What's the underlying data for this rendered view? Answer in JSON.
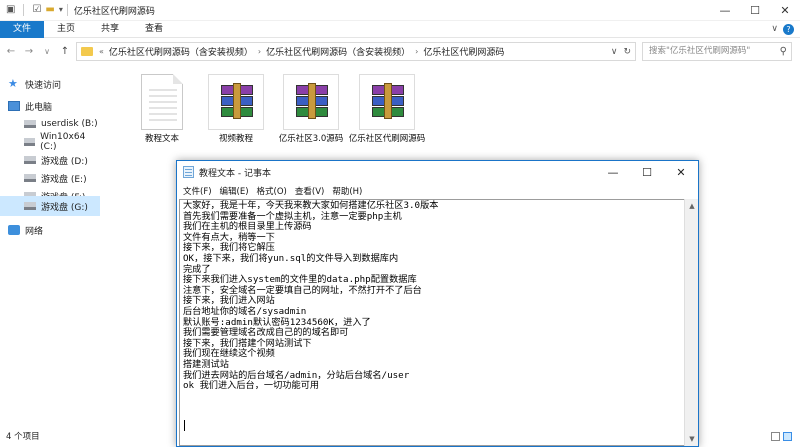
{
  "explorer": {
    "title": "亿乐社区代刷网源码",
    "qa_icons": [
      "window-icon",
      "properties-icon",
      "folder-icon",
      "dropdown-icon"
    ],
    "window_controls": {
      "minimize": "—",
      "maximize": "☐",
      "close": "✕"
    },
    "ribbon_tabs": [
      "文件",
      "主页",
      "共享",
      "查看"
    ],
    "ribbon_chevron": "∨",
    "help": "?",
    "nav_buttons": {
      "back": "←",
      "forward": "→",
      "recent": "∨",
      "up": "↑"
    },
    "breadcrumb": {
      "prefix": "«",
      "items": [
        "亿乐社区代刷网源码（含安装视频）",
        "亿乐社区代刷网源码（含安装视频）",
        "亿乐社区代刷网源码"
      ],
      "separator": "›"
    },
    "address_right": {
      "dropdown": "∨",
      "refresh": "↻"
    },
    "search_placeholder": "搜索\"亿乐社区代刷网源码\"",
    "nav_pane": [
      {
        "label": "快速访问",
        "icon": "star-icon"
      },
      {
        "label": "此电脑",
        "icon": "computer-icon"
      },
      {
        "label": "userdisk (B:)",
        "icon": "drive-icon"
      },
      {
        "label": "Win10x64 (C:)",
        "icon": "drive-icon"
      },
      {
        "label": "游戏盘 (D:)",
        "icon": "drive-icon"
      },
      {
        "label": "游戏盘 (E:)",
        "icon": "drive-icon"
      },
      {
        "label": "游戏盘 (F:)",
        "icon": "drive-icon"
      },
      {
        "label": "游戏盘 (G:)",
        "icon": "drive-icon"
      },
      {
        "label": "网络",
        "icon": "network-icon"
      }
    ],
    "selected_nav": "游戏盘 (G:)",
    "files": [
      {
        "name": "教程文本",
        "type": "text-document"
      },
      {
        "name": "视频教程",
        "type": "archive"
      },
      {
        "name": "亿乐社区3.0源码",
        "type": "archive"
      },
      {
        "name": "亿乐社区代刷网源码",
        "type": "archive"
      }
    ],
    "status": "4 个项目"
  },
  "notepad": {
    "title": "教程文本 - 记事本",
    "window_controls": {
      "minimize": "—",
      "maximize": "☐",
      "close": "✕"
    },
    "menu": [
      "文件(F)",
      "编辑(E)",
      "格式(O)",
      "查看(V)",
      "帮助(H)"
    ],
    "lines": [
      "大家好，我是十年，今天我来教大家如何搭建亿乐社区3.0版本",
      "首先我们需要准备一个虚拟主机，注意一定要php主机",
      "我们在主机的根目录里上传源码",
      "文件有点大，稍等一下",
      "接下来，我们将它解压",
      "OK，接下来，我们将yun.sql的文件导入到数据库内",
      "完成了",
      "接下来我们进入system的文件里的data.php配置数据库",
      "注意下，安全域名一定要填自己的网址，不然打开不了后台",
      "接下来，我们进入网站",
      "后台地址你的域名/sysadmin",
      "默认账号:admin默认密码1234560K，进入了",
      "我们需要管理域名改成自己的的域名即可",
      "接下来，我们搭建个网站测试下",
      "我们现在继续这个视频",
      "搭建测试站",
      "我们进去网站的后台域名/admin，分站后台域名/user",
      "ok 我们进入后台，一切功能可用"
    ],
    "scroll_up": "▲",
    "scroll_down": "▼"
  }
}
